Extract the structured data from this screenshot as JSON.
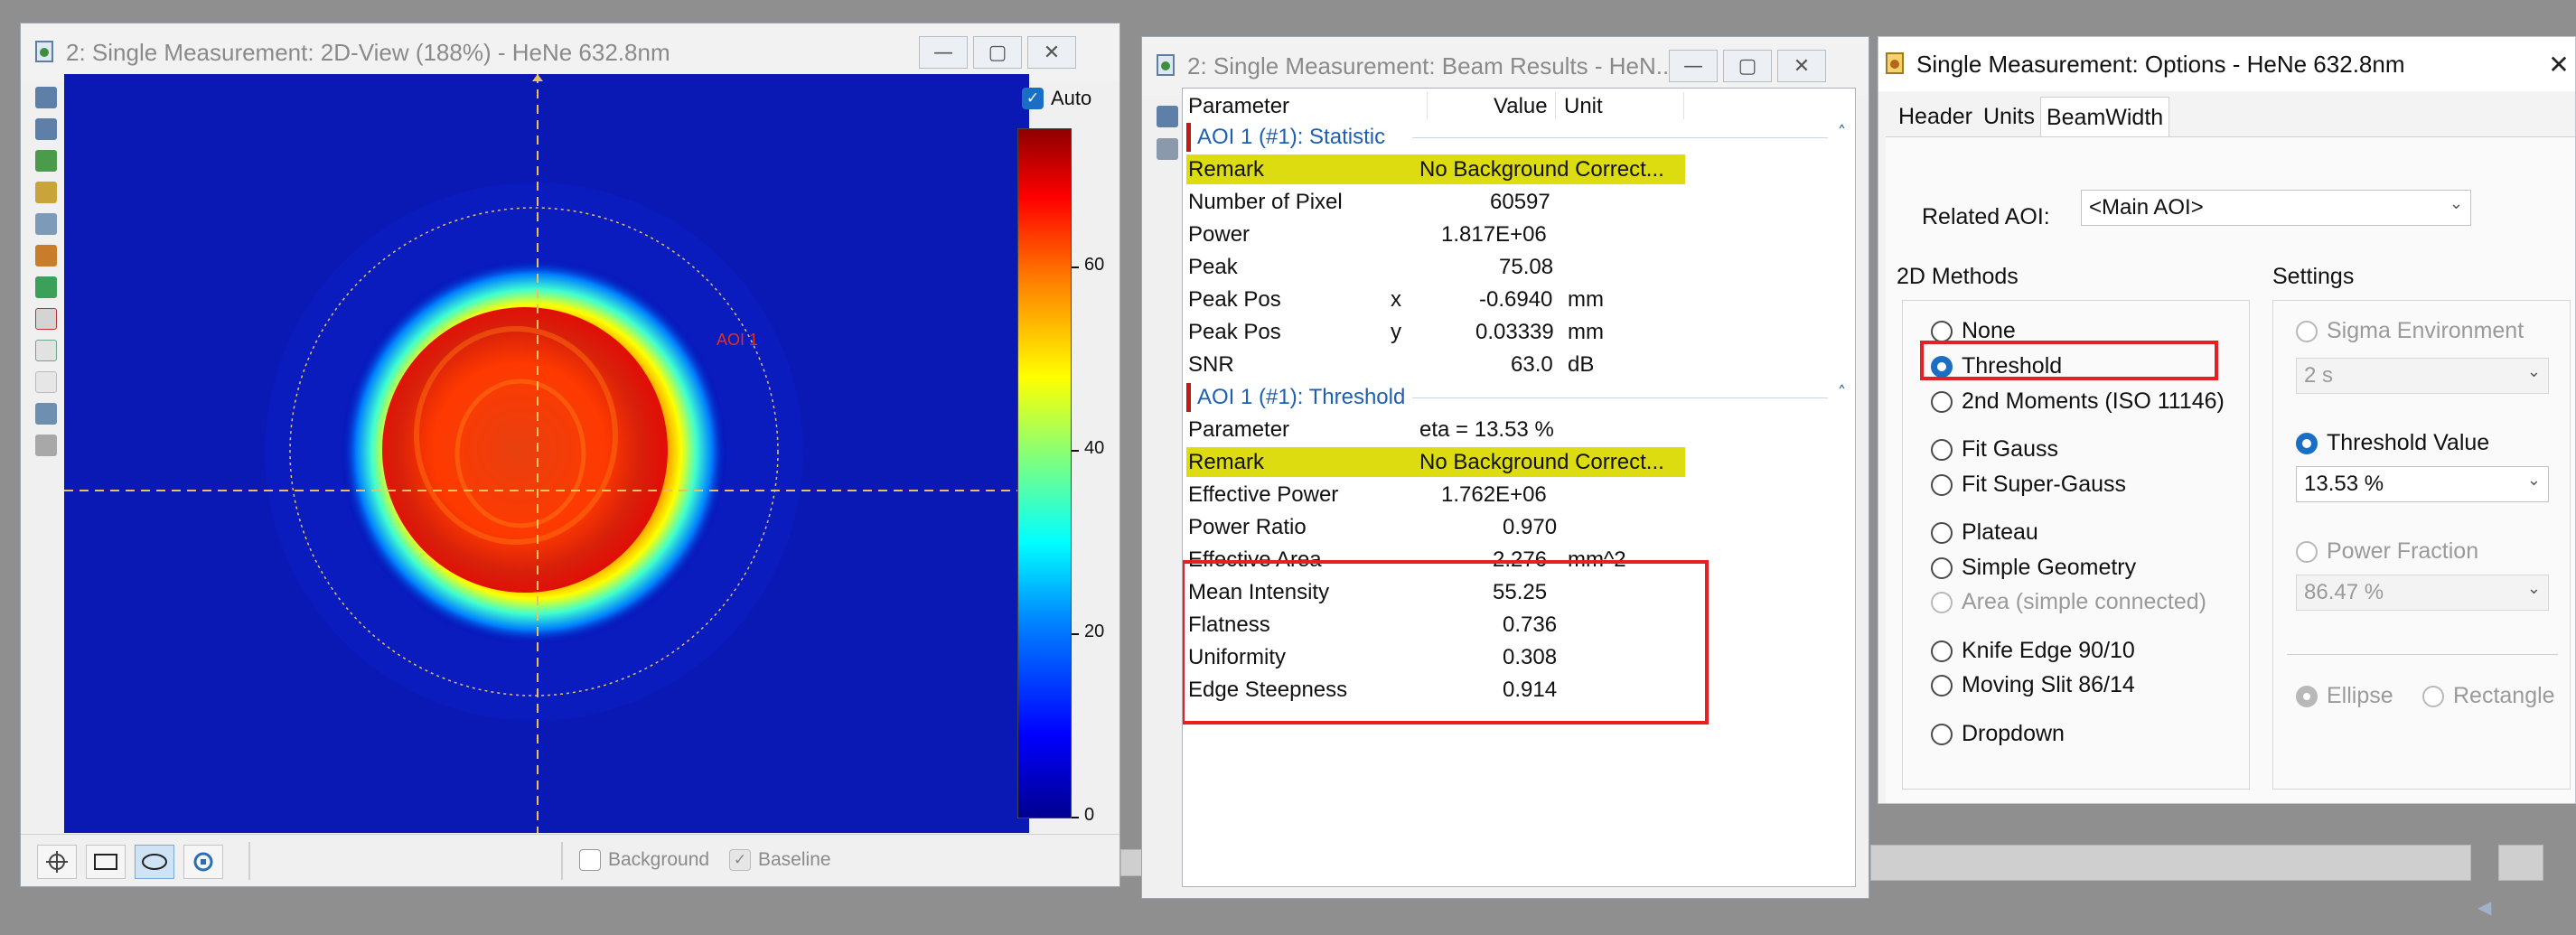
{
  "windows": {
    "view2d": {
      "title": "2: Single Measurement: 2D-View (188%) - HeNe 632.8nm",
      "auto_label": "Auto",
      "aoi_label": "AOI 1",
      "colorbar_labels": [
        "60",
        "40",
        "20",
        "0"
      ],
      "bottom": {
        "background_label": "Background",
        "baseline_label": "Baseline"
      }
    },
    "results": {
      "title": "2: Single Measurement: Beam Results - HeN...",
      "columns": {
        "parameter": "Parameter",
        "value": "Value",
        "unit": "Unit"
      },
      "section_statistic": "AOI 1 (#1): Statistic",
      "section_threshold": "AOI 1 (#1): Threshold",
      "statistic_rows": [
        {
          "name": "Remark",
          "axis": "",
          "value": "No Background Correct...",
          "unit": "",
          "highlight": true
        },
        {
          "name": "Number of Pixel",
          "axis": "",
          "value": "60597",
          "unit": ""
        },
        {
          "name": "Power",
          "axis": "",
          "value": "1.817E+06",
          "unit": ""
        },
        {
          "name": "Peak",
          "axis": "",
          "value": "75.08",
          "unit": ""
        },
        {
          "name": "Peak Pos",
          "axis": "x",
          "value": "-0.6940",
          "unit": "mm"
        },
        {
          "name": "Peak Pos",
          "axis": "y",
          "value": "0.03339",
          "unit": "mm"
        },
        {
          "name": "SNR",
          "axis": "",
          "value": "63.0",
          "unit": "dB"
        }
      ],
      "threshold_rows": [
        {
          "name": "Parameter",
          "axis": "",
          "value": "eta = 13.53 %",
          "unit": ""
        },
        {
          "name": "Remark",
          "axis": "",
          "value": "No Background Correct...",
          "unit": "",
          "highlight": true
        },
        {
          "name": "Effective Power",
          "axis": "",
          "value": "1.762E+06",
          "unit": ""
        },
        {
          "name": "Power Ratio",
          "axis": "",
          "value": "0.970",
          "unit": ""
        },
        {
          "name": "Effective Area",
          "axis": "",
          "value": "2.276",
          "unit": "mm^2"
        },
        {
          "name": "Mean Intensity",
          "axis": "",
          "value": "55.25",
          "unit": ""
        },
        {
          "name": "Flatness",
          "axis": "",
          "value": "0.736",
          "unit": ""
        },
        {
          "name": "Uniformity",
          "axis": "",
          "value": "0.308",
          "unit": ""
        },
        {
          "name": "Edge Steepness",
          "axis": "",
          "value": "0.914",
          "unit": ""
        }
      ]
    },
    "options": {
      "title": "Single Measurement: Options - HeNe 632.8nm",
      "tabs": [
        "Header",
        "Units",
        "BeamWidth"
      ],
      "active_tab": "BeamWidth",
      "related_aoi_label": "Related AOI:",
      "related_aoi_value": "<Main AOI>",
      "methods_title": "2D Methods",
      "methods": [
        {
          "label": "None",
          "selected": false,
          "disabled": false
        },
        {
          "label": "Threshold",
          "selected": true,
          "disabled": false
        },
        {
          "label": "2nd Moments (ISO 11146)",
          "selected": false,
          "disabled": false
        },
        {
          "label": "Fit Gauss",
          "selected": false,
          "disabled": false
        },
        {
          "label": "Fit Super-Gauss",
          "selected": false,
          "disabled": false
        },
        {
          "label": "Plateau",
          "selected": false,
          "disabled": false
        },
        {
          "label": "Simple Geometry",
          "selected": false,
          "disabled": false
        },
        {
          "label": "Area (simple connected)",
          "selected": false,
          "disabled": true
        },
        {
          "label": "Knife Edge 90/10",
          "selected": false,
          "disabled": false
        },
        {
          "label": "Moving Slit 86/14",
          "selected": false,
          "disabled": false
        },
        {
          "label": "Dropdown",
          "selected": false,
          "disabled": false
        }
      ],
      "settings_title": "Settings",
      "sigma_label": "Sigma Environment",
      "sigma_value": "2 s",
      "threshold_label": "Threshold Value",
      "threshold_value": "13.53 %",
      "power_fraction_label": "Power Fraction",
      "power_fraction_value": "86.47 %",
      "ellipse_label": "Ellipse",
      "rectangle_label": "Rectangle"
    }
  },
  "colors": {
    "highlight": "#dcdc10",
    "selection_box": "#e62020",
    "accent": "#1a6fc4",
    "section_text": "#1d5fb3"
  }
}
